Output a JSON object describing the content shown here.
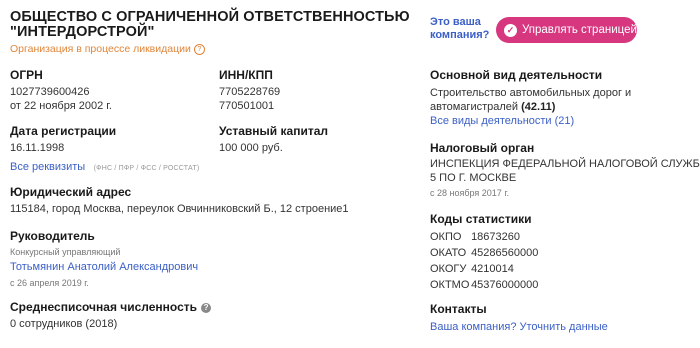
{
  "company": {
    "name_line1": "ОБЩЕСТВО С ОГРАНИЧЕННОЙ ОТВЕТСТВЕННОСТЬЮ",
    "name_line2": "\"ИНТЕРДОРСТРОЙ\"",
    "status": "Организация в процессе ликвидации"
  },
  "owner_prompt": {
    "line1": "Это ваша",
    "line2": "компания?"
  },
  "manage_button": "Управлять страницей",
  "ogrn": {
    "label": "ОГРН",
    "value": "1027739600426",
    "date": "от 22 ноября 2002 г."
  },
  "inn_kpp": {
    "label": "ИНН/КПП",
    "inn": "7705228769",
    "kpp": "770501001"
  },
  "registration": {
    "label": "Дата регистрации",
    "value": "16.11.1998",
    "details_link": "Все реквизиты",
    "sources": "(ФНС / ПФР / ФСС / РОССТАТ)"
  },
  "capital": {
    "label": "Уставный капитал",
    "value": "100 000 руб."
  },
  "address": {
    "label": "Юридический адрес",
    "value": "115184, город Москва, переулок Овчинниковский Б., 12 строение1"
  },
  "head": {
    "label": "Руководитель",
    "role": "Конкурсный управляющий",
    "name": "Тотьмянин Анатолий Александрович",
    "since": "с 26 апреля 2019 г."
  },
  "employees": {
    "label": "Среднесписочная численность",
    "value": "0 сотрудников (2018)"
  },
  "activity": {
    "label": "Основной вид деятельности",
    "line1": "Строительство автомобильных дорог и",
    "line2_text": "автомагистралей",
    "line2_code": "(42.11)",
    "all_link": "Все виды деятельности (21)"
  },
  "tax": {
    "label": "Налоговый орган",
    "line1": "ИНСПЕКЦИЯ ФЕДЕРАЛЬНОЙ НАЛОГОВОЙ СЛУЖБЫ №",
    "line2": "5 ПО Г. МОСКВЕ",
    "since": "с 28 ноября 2017 г."
  },
  "stats": {
    "label": "Коды статистики",
    "rows": [
      {
        "k": "ОКПО",
        "v": "18673260"
      },
      {
        "k": "ОКАТО",
        "v": "45286560000"
      },
      {
        "k": "ОКОГУ",
        "v": "4210014"
      },
      {
        "k": "ОКТМО",
        "v": "45376000000"
      }
    ]
  },
  "contacts": {
    "label": "Контакты",
    "link": "Ваша компания? Уточнить данные"
  },
  "colors": {
    "accent": "#d6377f",
    "link": "#3b5fc6",
    "status": "#e0863a"
  }
}
